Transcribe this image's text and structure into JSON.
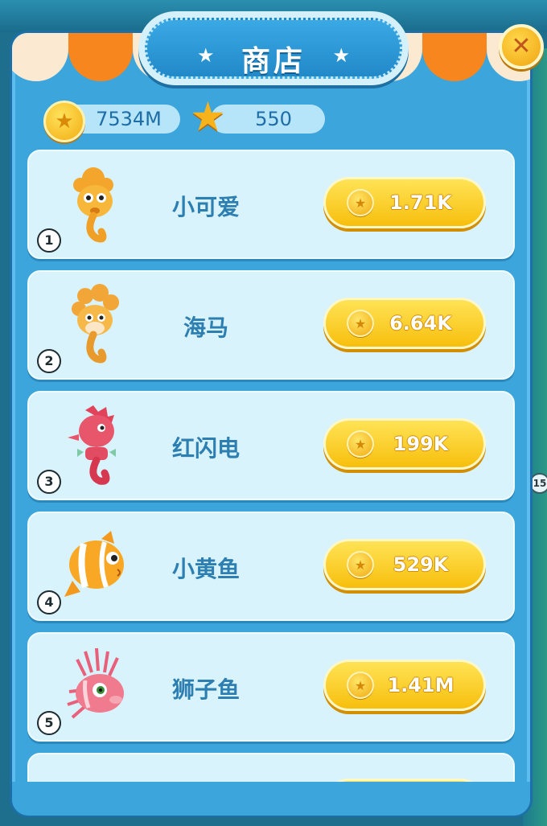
{
  "title": "商店",
  "edge_label": "15",
  "currencies": [
    {
      "icon": "coin-icon",
      "amount": "7534M"
    },
    {
      "icon": "star-icon",
      "amount": "550"
    }
  ],
  "items": [
    {
      "index": "1",
      "name": "小可爱",
      "price": "1.71K",
      "creature": "yellow-seahorse"
    },
    {
      "index": "2",
      "name": "海马",
      "price": "6.64K",
      "creature": "curly-seahorse"
    },
    {
      "index": "3",
      "name": "红闪电",
      "price": "199K",
      "creature": "red-seahorse"
    },
    {
      "index": "4",
      "name": "小黄鱼",
      "price": "529K",
      "creature": "clownfish"
    },
    {
      "index": "5",
      "name": "狮子鱼",
      "price": "1.41M",
      "creature": "lionfish"
    }
  ],
  "colors": {
    "panel": "#3ba5dc",
    "card": "#d8f3fc",
    "button": "#f7bf0d",
    "name_text": "#2e7fb1"
  }
}
